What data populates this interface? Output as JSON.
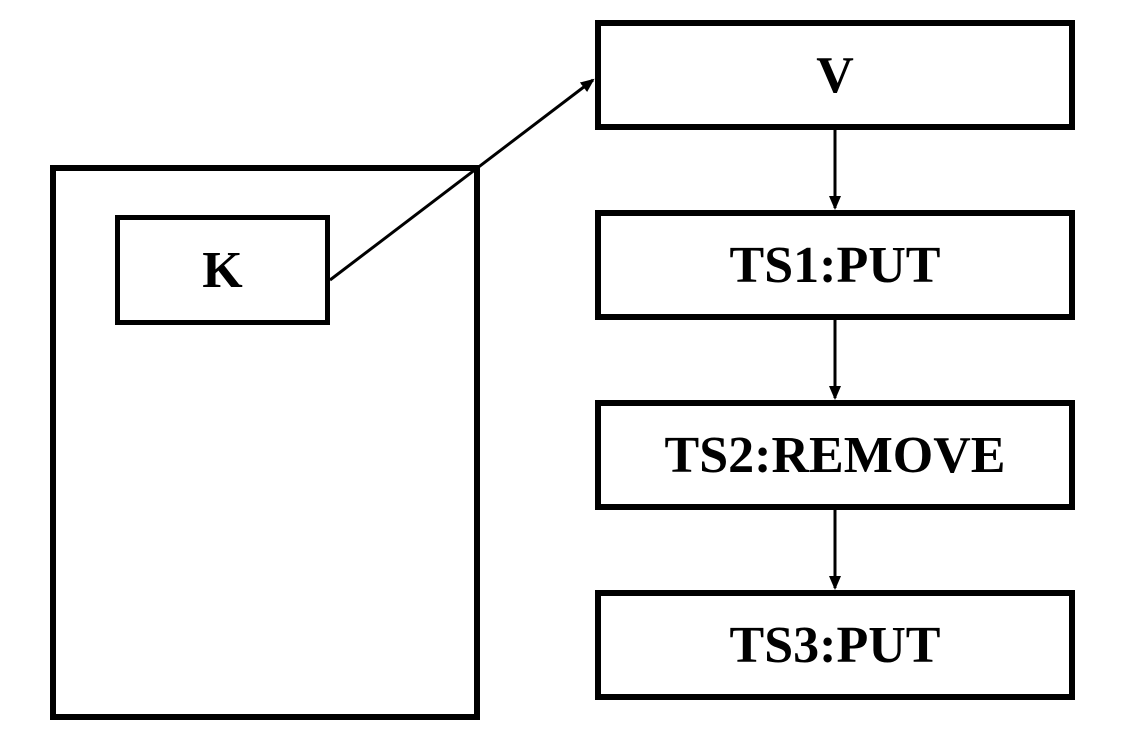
{
  "diagram": {
    "k_label": "K",
    "nodes": [
      {
        "id": "v",
        "label": "V"
      },
      {
        "id": "ts1",
        "label": "TS1:PUT"
      },
      {
        "id": "ts2",
        "label": "TS2:REMOVE"
      },
      {
        "id": "ts3",
        "label": "TS3:PUT"
      }
    ]
  }
}
